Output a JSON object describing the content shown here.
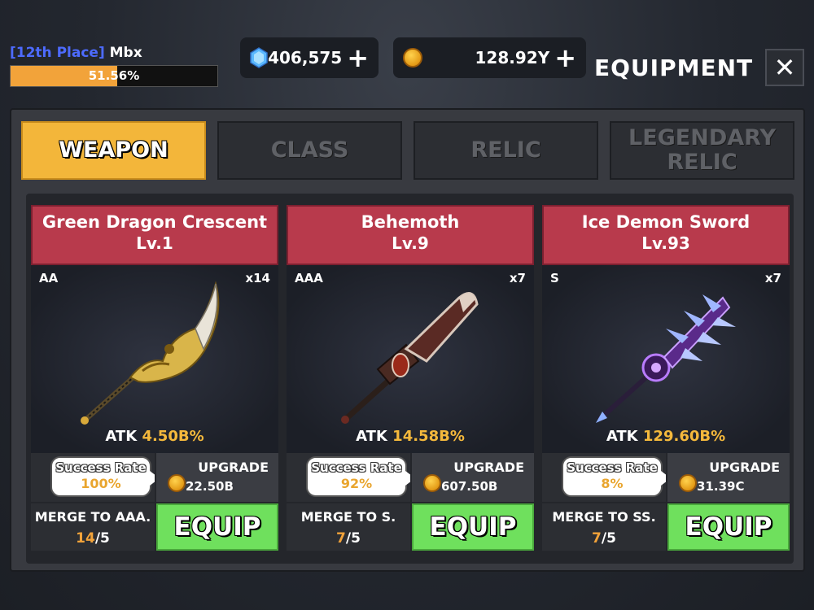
{
  "player": {
    "rank": "[12th Place]",
    "name": "Mbx",
    "xp_percent": 51.56,
    "xp_label": "51.56%"
  },
  "currencies": {
    "gems": {
      "icon": "gem-icon",
      "value": "406,575",
      "plus": "+"
    },
    "gold": {
      "icon": "coin-icon",
      "value": "128.92Y",
      "plus": "+"
    }
  },
  "screen": {
    "title": "EQUIPMENT",
    "close": "✕"
  },
  "tabs": [
    {
      "label": "WEAPON",
      "active": true
    },
    {
      "label": "CLASS",
      "active": false
    },
    {
      "label": "RELIC",
      "active": false
    },
    {
      "label": "LEGENDARY RELIC",
      "active": false
    }
  ],
  "weapons": [
    {
      "name": "Green Dragon Crescent",
      "level": "Lv.1",
      "grade": "AA",
      "count": "x14",
      "atk_label": "ATK",
      "atk_value": "4.50B%",
      "rate_label": "Success Rate",
      "rate_value": "100%",
      "upgrade_label": "UPGRADE",
      "upgrade_cost": "22.50B",
      "merge_label": "MERGE TO AAA.",
      "merge_current": "14",
      "merge_total": "/5",
      "equip_label": "EQUIP"
    },
    {
      "name": "Behemoth",
      "level": "Lv.9",
      "grade": "AAA",
      "count": "x7",
      "atk_label": "ATK",
      "atk_value": "14.58B%",
      "rate_label": "Success Rate",
      "rate_value": "92%",
      "upgrade_label": "UPGRADE",
      "upgrade_cost": "607.50B",
      "merge_label": "MERGE TO S.",
      "merge_current": "7",
      "merge_total": "/5",
      "equip_label": "EQUIP"
    },
    {
      "name": "Ice Demon Sword",
      "level": "Lv.93",
      "grade": "S",
      "count": "x7",
      "atk_label": "ATK",
      "atk_value": "129.60B%",
      "rate_label": "Success Rate",
      "rate_value": "8%",
      "upgrade_label": "UPGRADE",
      "upgrade_cost": "31.39C",
      "merge_label": "MERGE TO SS.",
      "merge_current": "7",
      "merge_total": "/5",
      "equip_label": "EQUIP"
    }
  ],
  "colors": {
    "tab_active": "#f3b63a",
    "card_header": "#b83a4c",
    "equip_button": "#6fe05d",
    "highlight": "#f5b93c",
    "rank_text": "#4d6bff"
  }
}
